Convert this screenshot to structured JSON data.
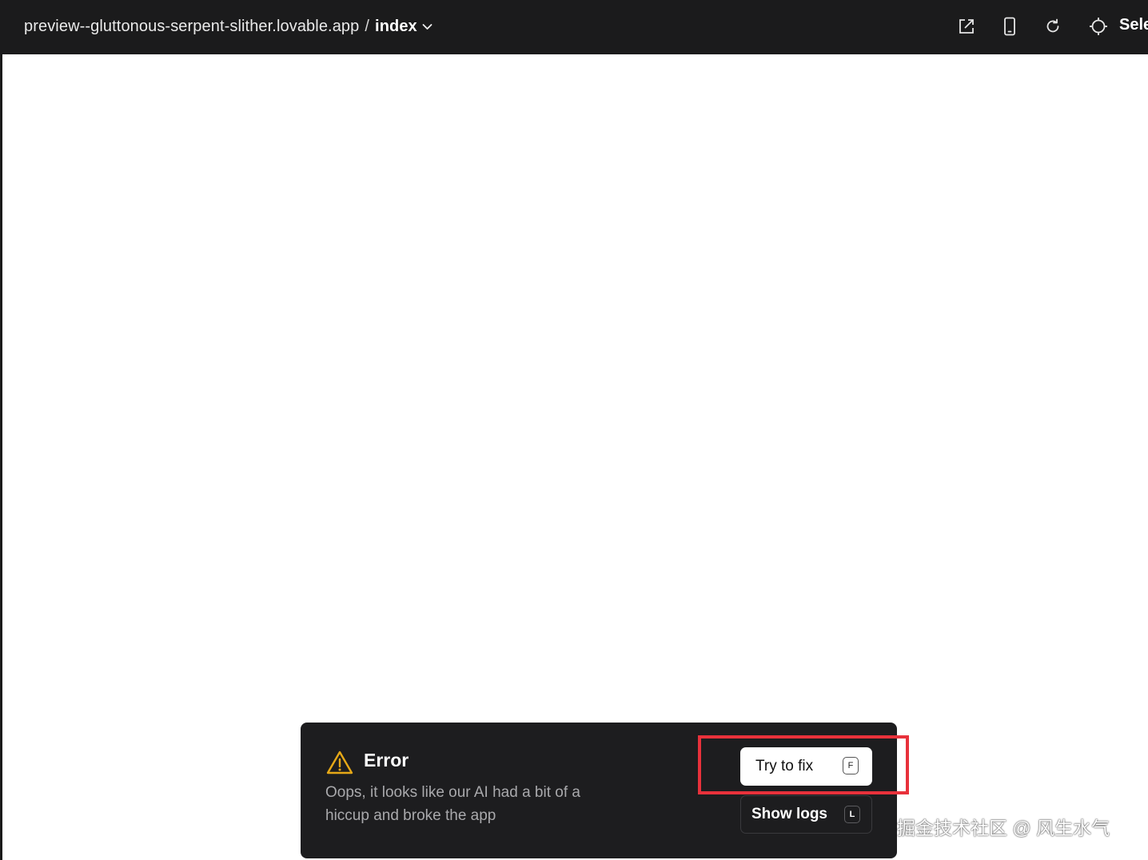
{
  "topbar": {
    "host": "preview--gluttonous-serpent-slither.lovable.app",
    "separator": "/",
    "page": "index",
    "select_label": "Sele"
  },
  "icons": {
    "open_external": "open-external-icon",
    "mobile": "mobile-device-icon",
    "refresh": "refresh-icon",
    "select": "crosshair-icon",
    "chevron": "chevron-down-icon",
    "warning": "warning-triangle-icon"
  },
  "error": {
    "title": "Error",
    "message": "Oops, it looks like our AI had a bit of a hiccup and broke the app",
    "try_fix_label": "Try to fix",
    "try_fix_shortcut": "F",
    "show_logs_label": "Show logs",
    "show_logs_shortcut": "L"
  },
  "annotation": {
    "highlight_color": "#e8313b"
  },
  "watermark": {
    "text": "掘金技术社区 @ 风生水气"
  },
  "colors": {
    "topbar_bg": "#1b1b1c",
    "panel_bg": "#1d1d1f",
    "warning": "#e6a817"
  }
}
